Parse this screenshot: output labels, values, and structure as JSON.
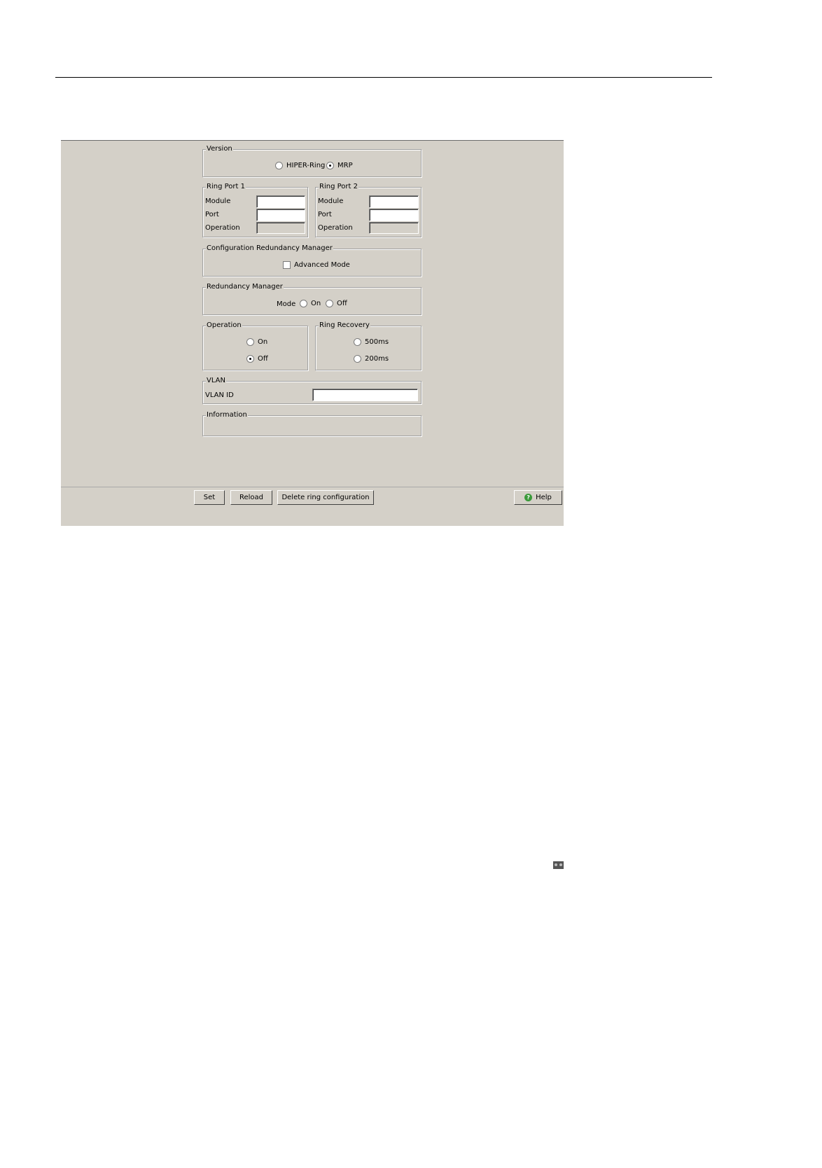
{
  "version": {
    "legend": "Version",
    "options": [
      {
        "label": "HIPER-Ring",
        "selected": false
      },
      {
        "label": "MRP",
        "selected": true
      }
    ]
  },
  "ring_port_1": {
    "legend": "Ring Port 1",
    "module_label": "Module",
    "module_value": "",
    "port_label": "Port",
    "port_value": "",
    "operation_label": "Operation",
    "operation_value": ""
  },
  "ring_port_2": {
    "legend": "Ring Port 2",
    "module_label": "Module",
    "module_value": "",
    "port_label": "Port",
    "port_value": "",
    "operation_label": "Operation",
    "operation_value": ""
  },
  "config_rm": {
    "legend": "Configuration Redundancy Manager",
    "advanced_mode_label": "Advanced Mode",
    "advanced_mode_checked": false
  },
  "redundancy_manager": {
    "legend": "Redundancy Manager",
    "mode_label": "Mode",
    "on_label": "On",
    "off_label": "Off"
  },
  "operation": {
    "legend": "Operation",
    "on_label": "On",
    "off_label": "Off",
    "selected": "Off"
  },
  "ring_recovery": {
    "legend": "Ring Recovery",
    "opt1_label": "500ms",
    "opt2_label": "200ms"
  },
  "vlan": {
    "legend": "VLAN",
    "id_label": "VLAN ID",
    "id_value": ""
  },
  "information": {
    "legend": "Information"
  },
  "buttons": {
    "set": "Set",
    "reload": "Reload",
    "delete": "Delete ring configuration",
    "help": "Help"
  }
}
